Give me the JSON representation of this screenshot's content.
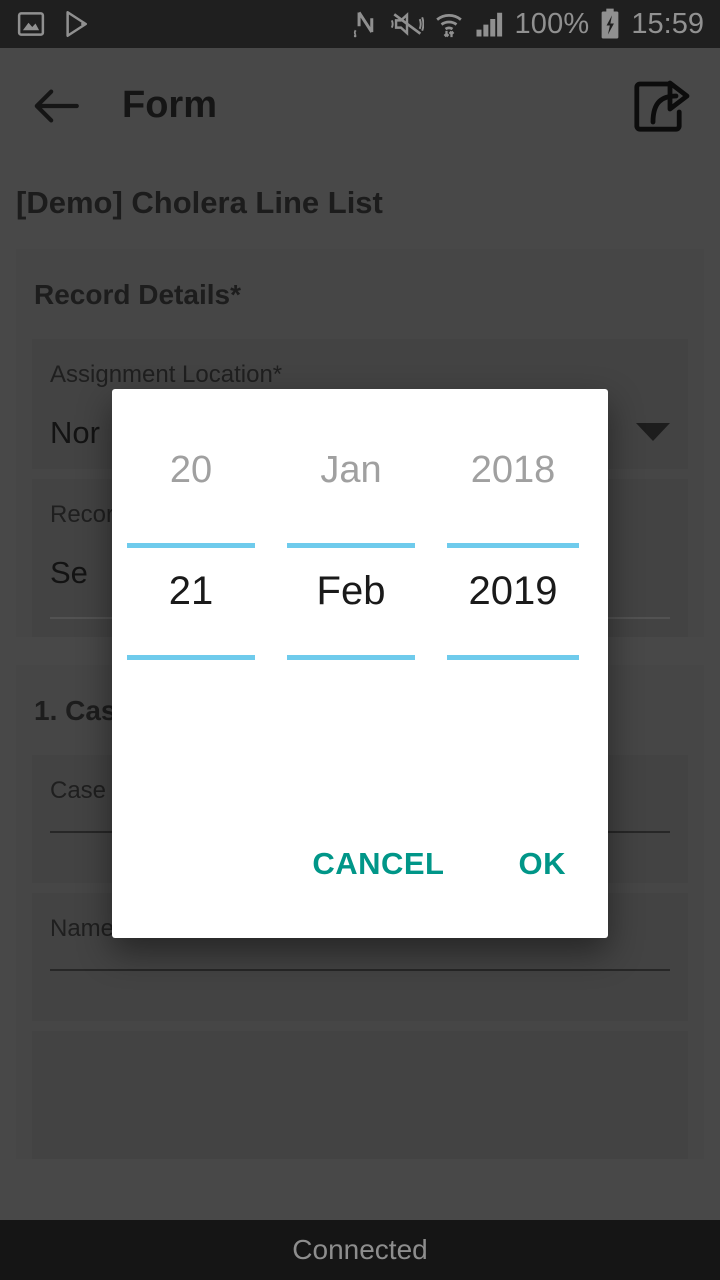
{
  "status_bar": {
    "left_icons": [
      "screenshot-icon",
      "google-play-icon"
    ],
    "right_icons": [
      "nfc-icon",
      "vibrate-mute-icon",
      "wifi-icon",
      "cellular-signal-icon"
    ],
    "battery_percent": "100%",
    "battery_icon": "battery-charging-icon",
    "time": "15:59"
  },
  "app_bar": {
    "back_icon": "back-arrow-icon",
    "title": "Form",
    "share_icon": "share-export-icon"
  },
  "form": {
    "title": "[Demo] Cholera Line List",
    "sections": [
      {
        "heading": "Record Details*",
        "fields": [
          {
            "label": "Assignment Location*",
            "value": "Nor",
            "type": "dropdown"
          },
          {
            "label": "Recor",
            "value": "Se",
            "type": "text"
          }
        ]
      },
      {
        "heading": "1. Cas",
        "fields": [
          {
            "label": "Case r",
            "value": "",
            "type": "text"
          },
          {
            "label": "Name of case",
            "value": "",
            "type": "text"
          }
        ]
      }
    ]
  },
  "date_picker": {
    "columns": [
      {
        "name": "day",
        "previous": "20",
        "selected": "21"
      },
      {
        "name": "month",
        "previous": "Jan",
        "selected": "Feb"
      },
      {
        "name": "year",
        "previous": "2018",
        "selected": "2019"
      }
    ],
    "cancel_label": "CANCEL",
    "ok_label": "OK",
    "accent_color": "#009688",
    "divider_color": "#6fcbec"
  },
  "connection_bar": {
    "status": "Connected"
  }
}
